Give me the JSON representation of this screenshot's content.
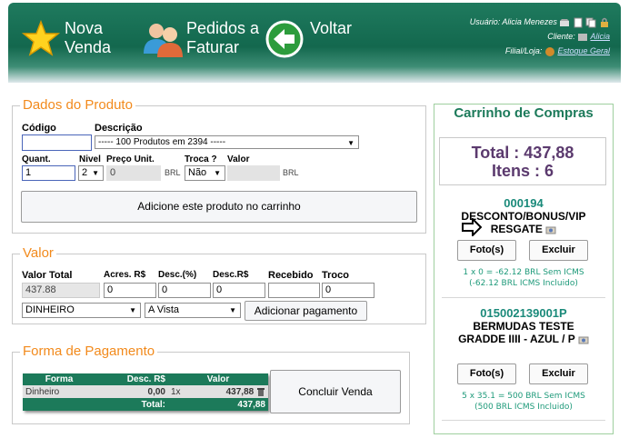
{
  "header": {
    "nav": [
      {
        "line1": "Nova",
        "line2": "Venda"
      },
      {
        "line1": "Pedidos a",
        "line2": "Faturar"
      },
      {
        "line1": "Voltar",
        "line2": ""
      }
    ],
    "user_label": "Usuário:",
    "user_name": "Alicia Menezes",
    "client_label": "Cliente:",
    "client_value": "Alicia",
    "store_label": "Filial/Loja:",
    "store_value": "Estoque Geral"
  },
  "produto": {
    "legend": "Dados do Produto",
    "codigo_label": "Código",
    "descricao_label": "Descrição",
    "descricao_value": "----- 100 Produtos em 2394 -----",
    "quant_label": "Quant.",
    "quant_value": "1",
    "nivel_label": "Nivel",
    "nivel_value": "2",
    "preco_label": "Preço Unit.",
    "preco_value": "0",
    "brl1": "BRL",
    "troca_label": "Troca ?",
    "troca_value": "Não",
    "valor_label": "Valor",
    "brl2": "BRL",
    "add_button": "Adicione este produto no carrinho"
  },
  "valor": {
    "legend": "Valor",
    "total_label": "Valor Total",
    "total_value": "437.88",
    "acres_label": "Acres. R$",
    "desc_pct_label": "Desc.(%)",
    "desc_rs_label": "Desc.R$",
    "acres_value": "0",
    "desc_pct_value": "0",
    "desc_rs_value": "0",
    "recebido_label": "Recebido",
    "troco_label": "Troco",
    "troco_value": "0",
    "forma_value": "DINHEIRO",
    "prazo_value": "A Vista",
    "add_pagamento": "Adicionar pagamento"
  },
  "forma": {
    "legend": "Forma de Pagamento",
    "headers": [
      "Forma",
      "Desc. R$",
      "Valor"
    ],
    "row": {
      "forma": "Dinheiro",
      "desc": "0,00",
      "qtd": "1x",
      "valor": "437,88"
    },
    "total_label": "Total:",
    "total_value": "437,88",
    "concluir": "Concluir Venda"
  },
  "carrinho": {
    "title": "Carrinho de Compras",
    "total_label": "Total :",
    "total_value": "437,88",
    "itens_label": "Itens :",
    "itens_value": "6",
    "items": [
      {
        "code": "000194",
        "name": "DESCONTO/BONUS/VIP RESGATE",
        "foto": "Foto(s)",
        "excluir": "Excluir",
        "note1": "1 x 0 = -62.12 BRL Sem ICMS",
        "note2": "(-62.12 BRL ICMS Incluido)"
      },
      {
        "code": "015002139001P",
        "name": "BERMUDAS TESTE GRADDE IIII - AZUL / P",
        "foto": "Foto(s)",
        "excluir": "Excluir",
        "note1": "5 x 35.1 = 500 BRL Sem ICMS",
        "note2": "(500 BRL ICMS Incluido)"
      }
    ]
  },
  "colors": {
    "brand_green": "#1c7a5a",
    "legend_orange": "#f28a1c",
    "cart_purple": "#5b3a6e"
  }
}
